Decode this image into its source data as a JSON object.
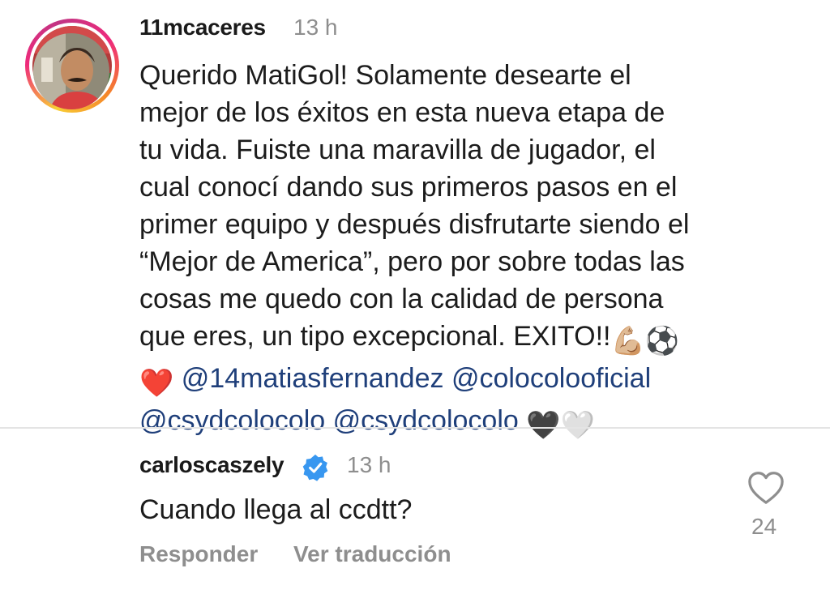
{
  "comments": [
    {
      "username": "11mcaceres",
      "time": "13 h",
      "lines": [
        "Querido MatiGol! Solamente desearte el",
        "mejor de los éxitos en esta nueva etapa de",
        "tu vida. Fuiste una maravilla de jugador, el",
        "cual conocí dando sus primeros pasos en el",
        "primer equipo y después disfrutarte siendo el",
        "“Mejor de America”, pero por sobre todas las",
        "cosas me quedo con la calidad de persona",
        "que eres, un tipo excepcional. EXITO!!"
      ],
      "mentions": [
        "@14matiasfernandez",
        "@colocolooficial",
        "@csydcolocolo",
        "@csydcolocolo"
      ],
      "emojis": {
        "muscle": "💪🏼",
        "soccer": "⚽",
        "red_heart": "❤️",
        "black_heart": "🖤",
        "white_heart": "🤍"
      }
    },
    {
      "username": "carloscaszely",
      "verified": true,
      "time": "13 h",
      "text": "Cuando llega al ccdtt?",
      "actions": {
        "reply": "Responder",
        "translate": "Ver traducción"
      },
      "like_count": "24"
    }
  ],
  "colors": {
    "mention": "#1f3f7a",
    "muted": "#8e8e8e",
    "verified": "#3897f0"
  }
}
